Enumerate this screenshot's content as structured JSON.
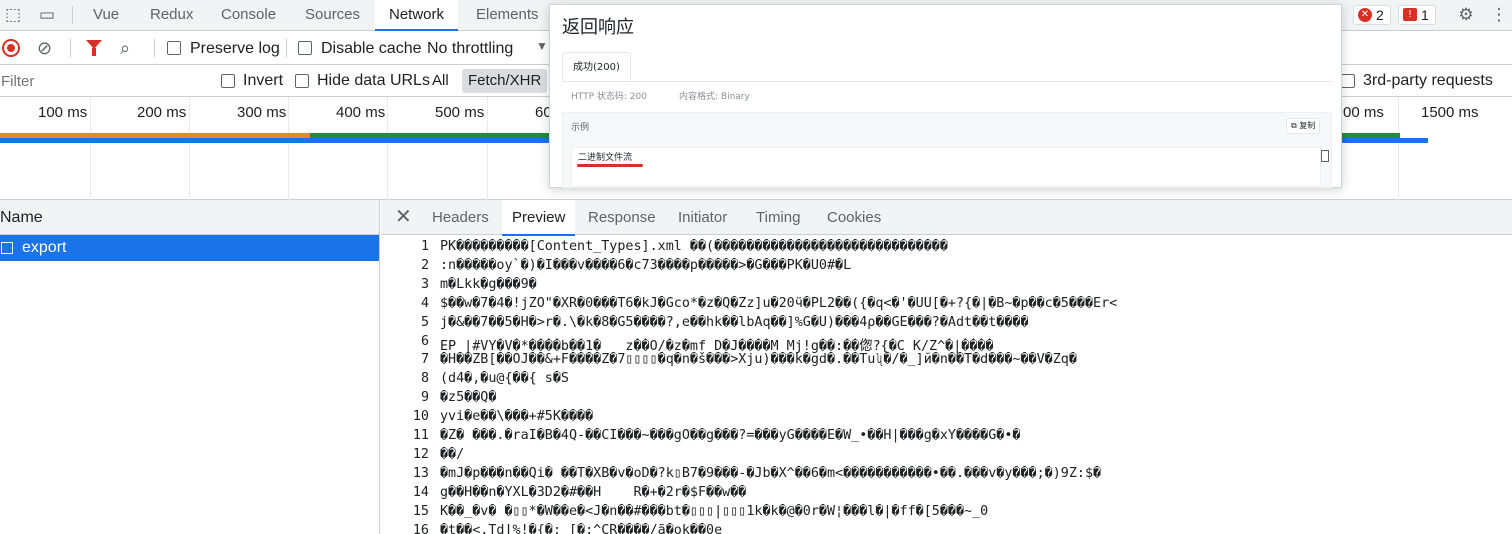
{
  "devtools": {
    "tabs": [
      {
        "label": "Vue"
      },
      {
        "label": "Redux"
      },
      {
        "label": "Console"
      },
      {
        "label": "Sources"
      },
      {
        "label": "Network"
      },
      {
        "label": "Elements"
      }
    ],
    "errors_count": "2",
    "warnings_count": "1"
  },
  "toolbar": {
    "preserve_log": "Preserve log",
    "disable_cache": "Disable cache",
    "throttling": "No throttling"
  },
  "filter": {
    "placeholder": "Filter",
    "invert": "Invert",
    "hide_data_urls": "Hide data URLs",
    "all": "All",
    "fetch_xhr": "Fetch/XHR",
    "third_party": "3rd-party requests"
  },
  "timeline": {
    "ticks": [
      "100 ms",
      "200 ms",
      "300 ms",
      "400 ms",
      "500 ms",
      "60",
      "00 ms",
      "1500 ms"
    ]
  },
  "requests": {
    "header": "Name",
    "items": [
      {
        "name": "export"
      }
    ]
  },
  "detail": {
    "tabs": [
      {
        "label": "Headers"
      },
      {
        "label": "Preview"
      },
      {
        "label": "Response"
      },
      {
        "label": "Initiator"
      },
      {
        "label": "Timing"
      },
      {
        "label": "Cookies"
      }
    ],
    "lines": [
      {
        "n": "1",
        "t": "PK���������[Content_Types].xml ��(�����������������������������"
      },
      {
        "n": "2",
        "t": ":n�����oy`�)�I���v����6�c73����p�����>�G���PK�U0#�L"
      },
      {
        "n": "3",
        "t": "m�Lkk�g���9�"
      },
      {
        "n": "4",
        "t": "$��w�7�4�!jZO\"�XR�0���T6�kJ�Gco*�z�Q�Zz]u�20ӵ�PL2��({�q<�'�UU[�+?{�|�B~�p��c�5���Er<"
      },
      {
        "n": "5",
        "t": "j�&��7��5�H�>r�.\\�k�8�G5����?,e��hk��lbAq��]%G�U)���4ρ��GE���?�Adt��t����"
      },
      {
        "n": "6",
        "t": "EP |#VY�V�*����b��1�   z��O/�z�mf D�J����M Mj!g��:��偬?{�C K/Z^�|����"
      },
      {
        "n": "7",
        "t": "�H��ZB[��OJ��&+F����Z�7▯▯▯▯�q�n�š���>Xju)���k�gd�.��Tuʯ�/�_]й�n��T�d���~��V�Zq�"
      },
      {
        "n": "8",
        "t": "(d4�,�u@{��{ s�S"
      },
      {
        "n": "9",
        "t": "�z5��Q�"
      },
      {
        "n": "10",
        "t": "yvi�e��\\���+#5K����"
      },
      {
        "n": "11",
        "t": "�Z� ���.�raI�B�4Q-��CI���~���gO��g���?=���yG����E�W_•��Ĥ|���g�xY����G�•�"
      },
      {
        "n": "12",
        "t": "��/"
      },
      {
        "n": "13",
        "t": "�mJ�p���n��Qi� ��T�XB�v�oD�?k▯B7�9���-�Jb�X^��6�m<�����������•��.���v�y���;�)9Z:$�"
      },
      {
        "n": "14",
        "t": "g��H��n�YXL�3D2�#��H    R�+�2r�$F��w��"
      },
      {
        "n": "15",
        "t": "K��_�v� �▯▯*�W��e�<J�n��#���bt�▯▯▯|▯▯▯1k�k�@�0r�W¦���l�|�ff�[5���~_0"
      },
      {
        "n": "16",
        "t": "�t��<.Tdǀ%!�{�; [�:^CR����/ã�ok��0e"
      }
    ]
  },
  "popup": {
    "title": "返回响应",
    "tab": "成功(200)",
    "status_label": "HTTP 状态码: 200",
    "content_type": "内容格式: Binary",
    "example_label": "示例",
    "copy_label": "复制",
    "body_text": "二进制文件流"
  }
}
